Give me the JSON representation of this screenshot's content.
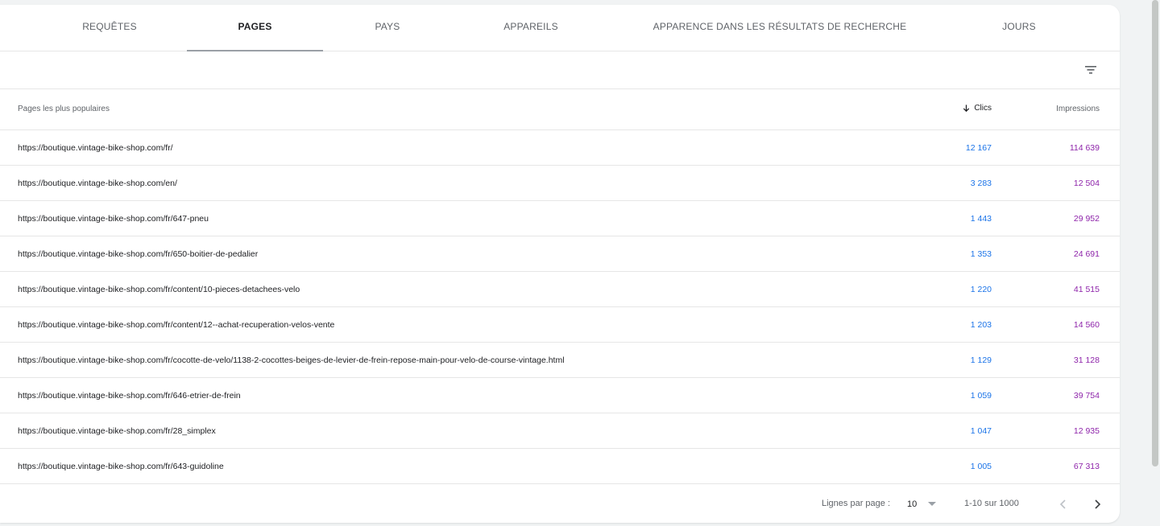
{
  "tabs": [
    {
      "label": "REQUÊTES"
    },
    {
      "label": "PAGES"
    },
    {
      "label": "PAYS"
    },
    {
      "label": "APPAREILS"
    },
    {
      "label": "APPARENCE DANS LES RÉSULTATS DE RECHERCHE"
    },
    {
      "label": "JOURS"
    }
  ],
  "active_tab": "PAGES",
  "toolbar": {
    "filter_icon": "filter-icon"
  },
  "table": {
    "headers": {
      "page": "Pages les plus populaires",
      "clicks": "Clics",
      "impressions": "Impressions",
      "sort_icon": "arrow-down-icon"
    },
    "rows": [
      {
        "url": "https://boutique.vintage-bike-shop.com/fr/",
        "clicks": "12 167",
        "impressions": "114 639"
      },
      {
        "url": "https://boutique.vintage-bike-shop.com/en/",
        "clicks": "3 283",
        "impressions": "12 504"
      },
      {
        "url": "https://boutique.vintage-bike-shop.com/fr/647-pneu",
        "clicks": "1 443",
        "impressions": "29 952"
      },
      {
        "url": "https://boutique.vintage-bike-shop.com/fr/650-boitier-de-pedalier",
        "clicks": "1 353",
        "impressions": "24 691"
      },
      {
        "url": "https://boutique.vintage-bike-shop.com/fr/content/10-pieces-detachees-velo",
        "clicks": "1 220",
        "impressions": "41 515"
      },
      {
        "url": "https://boutique.vintage-bike-shop.com/fr/content/12--achat-recuperation-velos-vente",
        "clicks": "1 203",
        "impressions": "14 560"
      },
      {
        "url": "https://boutique.vintage-bike-shop.com/fr/cocotte-de-velo/1138-2-cocottes-beiges-de-levier-de-frein-repose-main-pour-velo-de-course-vintage.html",
        "clicks": "1 129",
        "impressions": "31 128"
      },
      {
        "url": "https://boutique.vintage-bike-shop.com/fr/646-etrier-de-frein",
        "clicks": "1 059",
        "impressions": "39 754"
      },
      {
        "url": "https://boutique.vintage-bike-shop.com/fr/28_simplex",
        "clicks": "1 047",
        "impressions": "12 935"
      },
      {
        "url": "https://boutique.vintage-bike-shop.com/fr/643-guidoline",
        "clicks": "1 005",
        "impressions": "67 313"
      }
    ]
  },
  "pagination": {
    "rows_per_page_label": "Lignes par page :",
    "rows_per_page_value": "10",
    "range": "1-10 sur 1000"
  },
  "colors": {
    "clicks": "#1a73e8",
    "impressions": "#8e24aa"
  }
}
